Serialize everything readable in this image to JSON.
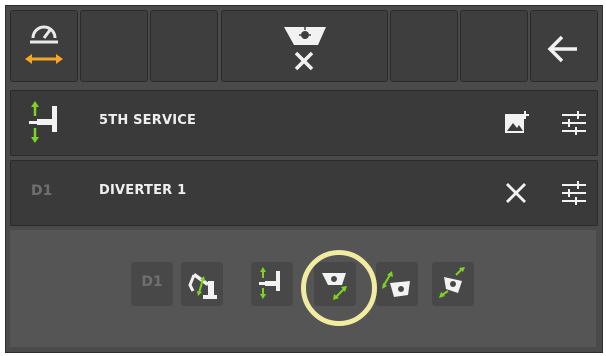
{
  "toolbar": {
    "buttons": [
      {
        "name": "speed-gauge-button",
        "icon": "speedometer-with-horizontal-arrows-icon"
      },
      {
        "name": "empty-toolbar-slot-1"
      },
      {
        "name": "empty-toolbar-slot-2"
      },
      {
        "name": "disable-light-button",
        "icon": "headlight-with-x-icon"
      },
      {
        "name": "empty-toolbar-slot-3"
      },
      {
        "name": "empty-toolbar-slot-4"
      },
      {
        "name": "back-button",
        "icon": "left-arrow-icon"
      }
    ]
  },
  "rows": [
    {
      "name": "fifth-service-row",
      "title": "5TH SERVICE",
      "icon": "fifth-service-icon",
      "actions": [
        "add-image-icon",
        "settings-sliders-icon"
      ]
    },
    {
      "name": "diverter-1-row",
      "badge": "D1",
      "title": "DIVERTER 1",
      "actions": [
        "close-icon",
        "settings-sliders-icon"
      ]
    }
  ],
  "diverter_selector": {
    "badge": "D1",
    "options": [
      {
        "name": "boom-function-option",
        "icon": "boom-arm-icon"
      },
      {
        "name": "fifth-service-option",
        "icon": "fifth-service-icon"
      },
      {
        "name": "bucket-tilt-option",
        "icon": "bucket-arrows-icon",
        "selected": true
      },
      {
        "name": "bucket-rotate-option",
        "icon": "bucket-rotate-icon"
      },
      {
        "name": "bucket-dump-option",
        "icon": "bucket-dump-icon"
      }
    ]
  },
  "colors": {
    "accent_orange": "#f5a623",
    "accent_green": "#7ed321",
    "highlight_ring": "#f2eca0",
    "panel": "#3a3a3a",
    "background": "#4a4a4a"
  }
}
